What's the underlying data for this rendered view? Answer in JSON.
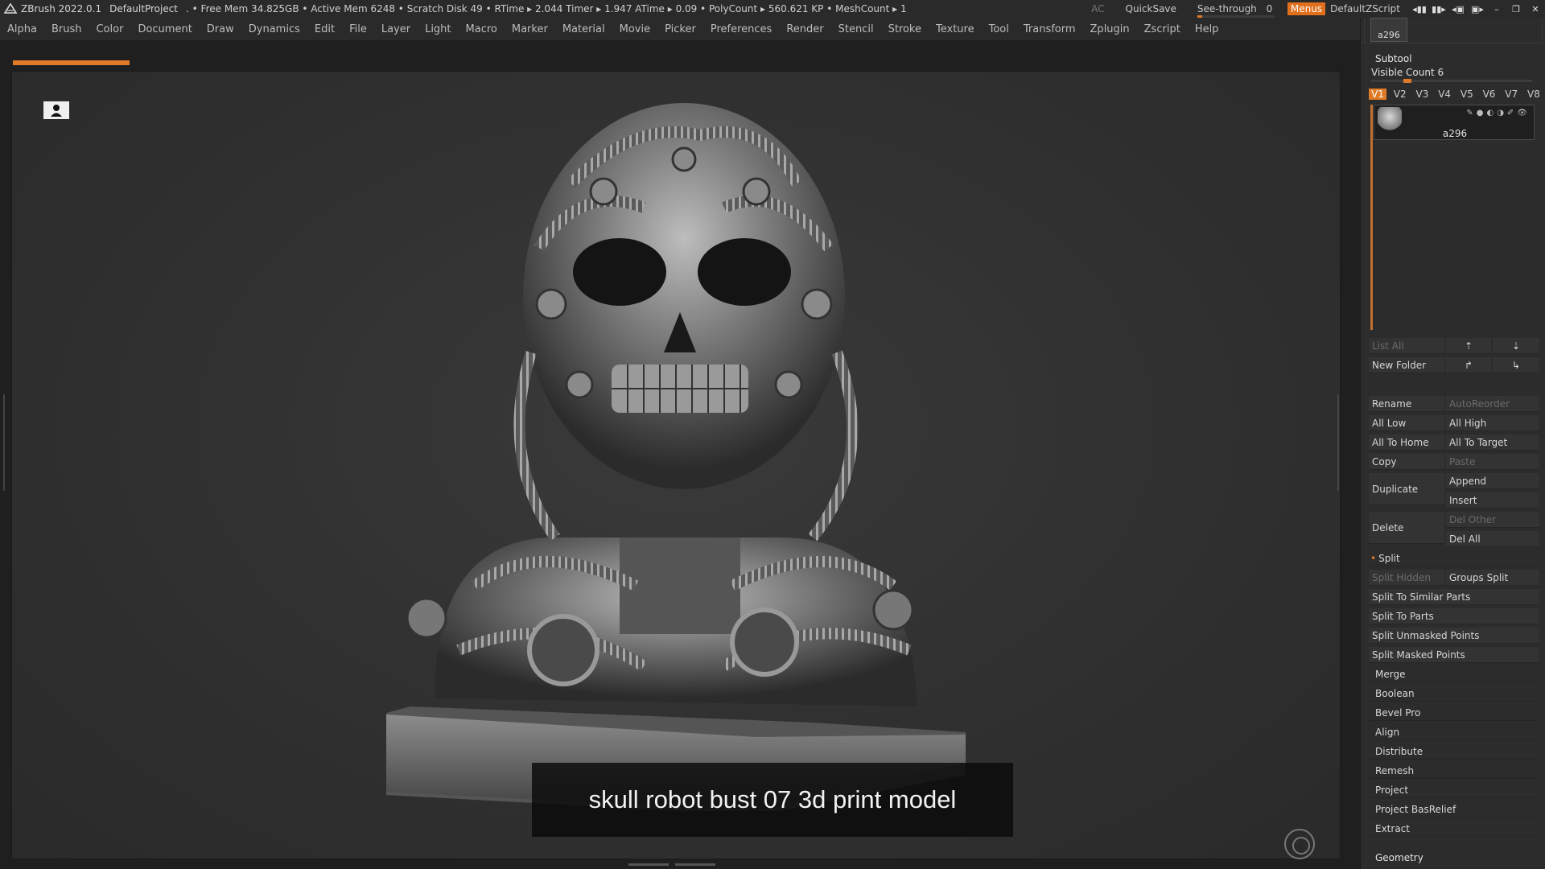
{
  "titlebar": {
    "app": "ZBrush 2022.0.1",
    "project": "DefaultProject",
    "stats": ". • Free Mem 34.825GB • Active Mem 6248 • Scratch Disk 49 •  RTime ▸ 2.044 Timer ▸ 1.947 ATime ▸ 0.09 • PolyCount ▸ 560.621 KP  • MeshCount ▸ 1",
    "ac": "AC",
    "quicksave": "QuickSave",
    "see_through_label": "See-through",
    "see_through_value": "0",
    "see_through_fraction": 0.0,
    "menus": "Menus",
    "zscript": "DefaultZScript"
  },
  "menubar": [
    "Alpha",
    "Brush",
    "Color",
    "Document",
    "Draw",
    "Dynamics",
    "Edit",
    "File",
    "Layer",
    "Light",
    "Macro",
    "Marker",
    "Material",
    "Movie",
    "Picker",
    "Preferences",
    "Render",
    "Stencil",
    "Stroke",
    "Texture",
    "Tool",
    "Transform",
    "Zplugin",
    "Zscript",
    "Help"
  ],
  "canvas": {
    "caption": "skull robot bust 07 3d print model"
  },
  "subtool": {
    "thumb_label": "a296",
    "title": "Subtool",
    "visible_count": "Visible Count 6",
    "versions": [
      "V1",
      "V2",
      "V3",
      "V4",
      "V5",
      "V6",
      "V7",
      "V8"
    ],
    "active_version": "V1",
    "item_name": "a296",
    "list_all": "List All",
    "new_folder": "New Folder",
    "rename": "Rename",
    "autoreorder": "AutoReorder",
    "all_low": "All Low",
    "all_high": "All High",
    "all_to_home": "All To Home",
    "all_to_target": "All To Target",
    "copy": "Copy",
    "paste": "Paste",
    "duplicate": "Duplicate",
    "append": "Append",
    "insert": "Insert",
    "delete": "Delete",
    "del_other": "Del Other",
    "del_all": "Del All",
    "split": "Split",
    "split_hidden": "Split Hidden",
    "groups_split": "Groups Split",
    "split_similar": "Split To Similar Parts",
    "split_parts": "Split To Parts",
    "split_unmasked": "Split Unmasked Points",
    "split_masked": "Split Masked Points",
    "sections": [
      "Merge",
      "Boolean",
      "Bevel Pro",
      "Align",
      "Distribute",
      "Remesh",
      "Project",
      "Project BasRelief",
      "Extract"
    ],
    "geometry": "Geometry"
  },
  "colors": {
    "accent": "#e07a27",
    "panel": "#2c2c2c",
    "canvas": "#333333"
  }
}
